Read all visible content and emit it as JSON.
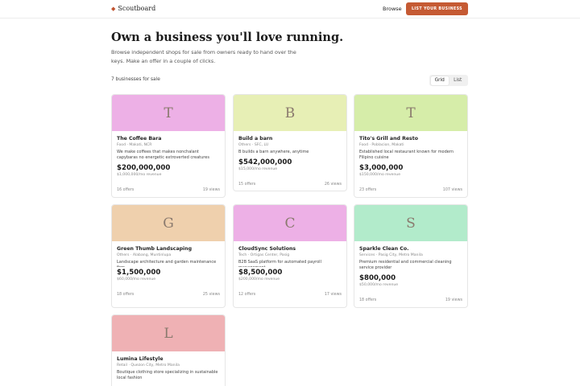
{
  "header": {
    "brand": "Scoutboard",
    "brand_mark": "◆",
    "nav_browse": "Browse",
    "cta_label": "LIST YOUR BUSINESS"
  },
  "hero": {
    "title": "Own a business you'll love running.",
    "subtitle": "Browse independent shops for sale from owners ready to hand over the keys. Make an offer in a couple of clicks."
  },
  "results": {
    "count_text": "7 businesses for sale",
    "view_options": [
      "Grid",
      "List"
    ],
    "active_view": "Grid"
  },
  "colors": {
    "accent": "#c55a33",
    "thumb_pink": "#edb0e6",
    "thumb_lime": "#e7efb5",
    "thumb_green": "#d6eda9",
    "thumb_peach": "#efd0ad",
    "thumb_mint": "#b2ebcb",
    "thumb_rose": "#efb1b4"
  },
  "listings": [
    {
      "initial": "T",
      "name": "The Coffee Bara",
      "meta": "Food · Makati, NCR",
      "desc": "We make coffees that makes nonchalant capybaras no energetic extroverted creatures",
      "price": "$200,000,000",
      "revenue": "$1,000,000/mo revenue",
      "offers": "16 offers",
      "views": "19 views"
    },
    {
      "initial": "B",
      "name": "Build a barn",
      "meta": "Others · SFC, LU",
      "desc": "B builds a barn anywhere, anytime",
      "price": "$542,000,000",
      "revenue": "$15,000/mo revenue",
      "offers": "15 offers",
      "views": "26 views"
    },
    {
      "initial": "T",
      "name": "Tito's Grill and Resto",
      "meta": "Food · Poblacion, Makati",
      "desc": "Established local restaurant known for modern Filipino cuisine",
      "price": "$3,000,000",
      "revenue": "$150,000/mo revenue",
      "offers": "23 offers",
      "views": "107 views"
    },
    {
      "initial": "G",
      "name": "Green Thumb Landscaping",
      "meta": "Others · Alabang, Muntinlupa",
      "desc": "Landscape architecture and garden maintenance firm",
      "price": "$1,500,000",
      "revenue": "$60,000/mo revenue",
      "offers": "18 offers",
      "views": "25 views"
    },
    {
      "initial": "C",
      "name": "CloudSync Solutions",
      "meta": "Tech · Ortigas Center, Pasig",
      "desc": "B2B SaaS platform for automated payroll management",
      "price": "$8,500,000",
      "revenue": "$200,000/mo revenue",
      "offers": "12 offers",
      "views": "17 views"
    },
    {
      "initial": "S",
      "name": "Sparkle Clean Co.",
      "meta": "Services · Pasig City, Metro Manila",
      "desc": "Premium residential and commercial cleaning service provider",
      "price": "$800,000",
      "revenue": "$50,000/mo revenue",
      "offers": "18 offers",
      "views": "19 views"
    },
    {
      "initial": "L",
      "name": "Lumina Lifestyle",
      "meta": "Retail · Quezon City, Metro Manila",
      "desc": "Boutique clothing store specializing in sustainable local fashion",
      "price": "",
      "revenue": "",
      "offers": "",
      "views": ""
    }
  ]
}
